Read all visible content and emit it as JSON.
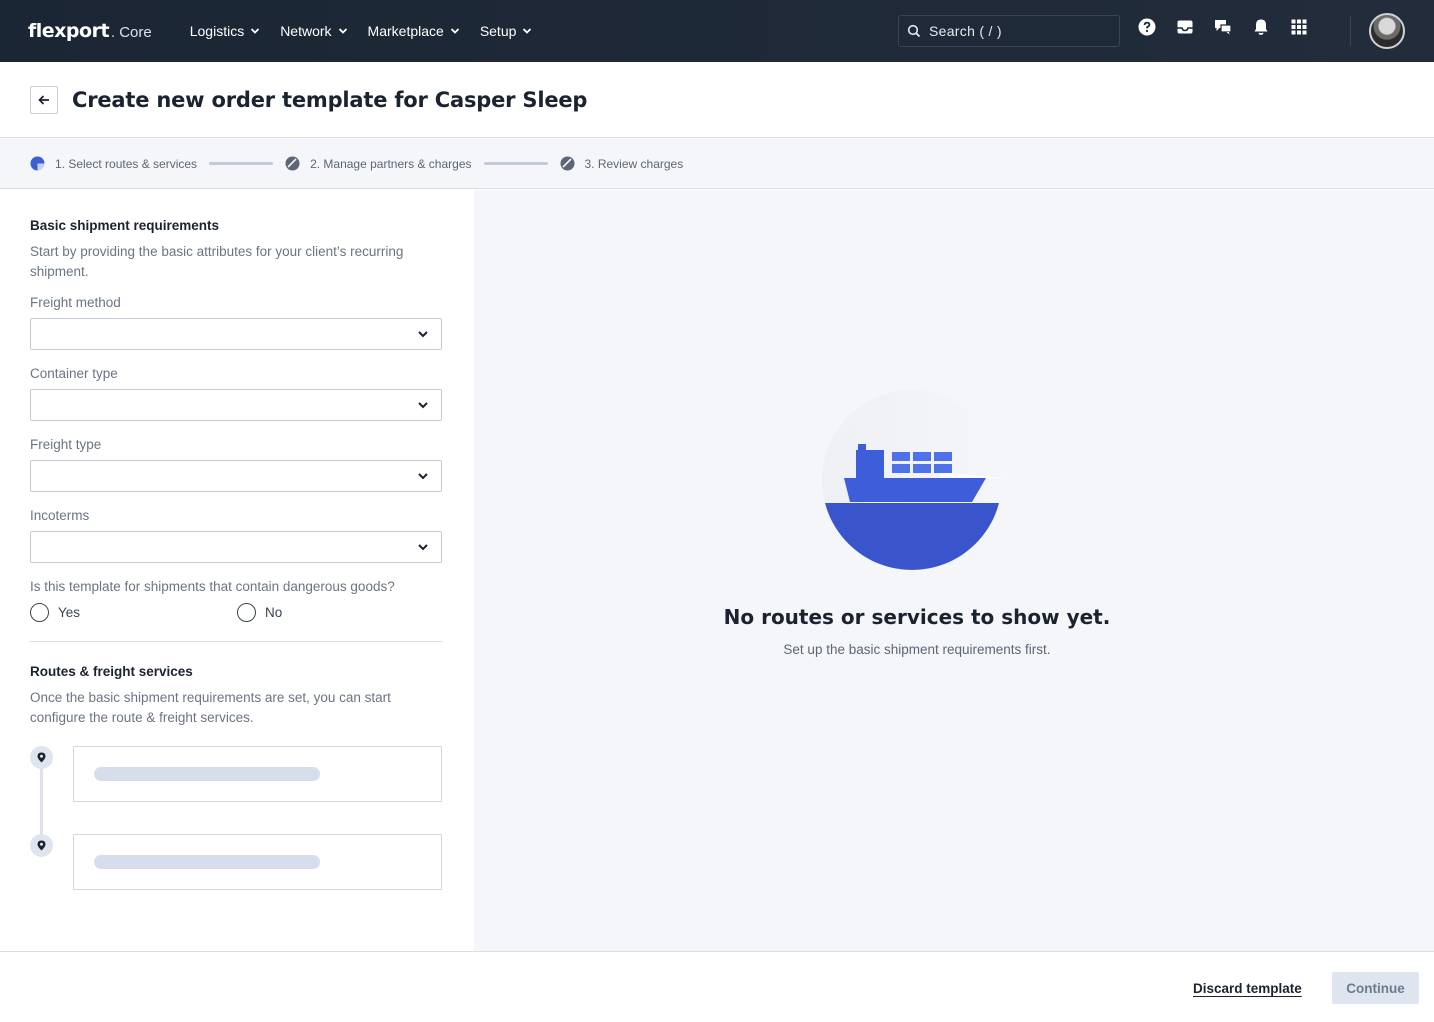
{
  "nav": {
    "logo": "flexport",
    "logo_dot": ".",
    "logo_product": "Core",
    "menu": [
      {
        "label": "Logistics"
      },
      {
        "label": "Network"
      },
      {
        "label": "Marketplace"
      },
      {
        "label": "Setup"
      }
    ],
    "search_placeholder": "Search ( / )",
    "icons": [
      "help-icon",
      "inbox-icon",
      "chat-icon",
      "bell-icon",
      "apps-grid-icon"
    ]
  },
  "header": {
    "title": "Create new order template for Casper Sleep"
  },
  "stepper": {
    "steps": [
      {
        "label": "1. Select routes & services",
        "state": "active"
      },
      {
        "label": "2. Manage partners & charges",
        "state": "inactive"
      },
      {
        "label": "3. Review charges",
        "state": "inactive"
      }
    ]
  },
  "form": {
    "basic_title": "Basic shipment requirements",
    "basic_desc": "Start by providing the basic attributes for your client’s recurring shipment.",
    "fields": [
      {
        "label": "Freight method",
        "value": ""
      },
      {
        "label": "Container type",
        "value": ""
      },
      {
        "label": "Freight type",
        "value": ""
      },
      {
        "label": "Incoterms",
        "value": ""
      }
    ],
    "dangerous_question": "Is this template for shipments that contain dangerous goods?",
    "radio_yes": "Yes",
    "radio_no": "No",
    "routes_title": "Routes & freight services",
    "routes_desc": "Once the basic shipment requirements are set, you can start configure the route & freight services."
  },
  "empty_state": {
    "title": "No routes or services to show yet.",
    "subtitle": "Set up the basic shipment requirements first."
  },
  "footer": {
    "discard_label": "Discard template",
    "continue_label": "Continue"
  },
  "colors": {
    "navbar": "#1b2634",
    "accent_blue": "#3d5ed8",
    "panel_bg": "#f4f6f9"
  }
}
